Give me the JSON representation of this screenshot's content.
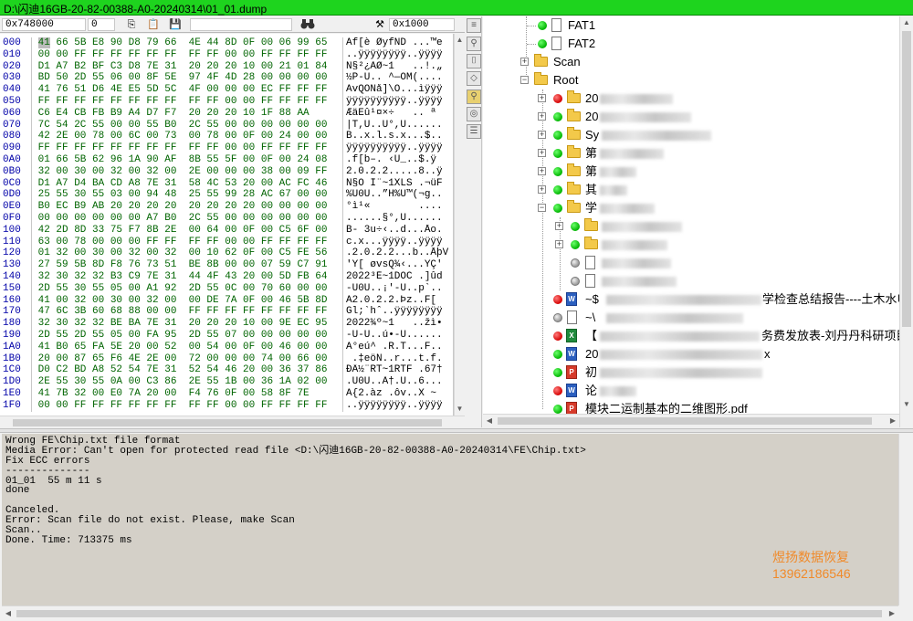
{
  "window": {
    "title": "D:\\闪迪16GB-20-82-00388-A0-20240314\\01_01.dump"
  },
  "hex_toolbar": {
    "offset": "0x748000",
    "value": "0",
    "search_icon": "binoculars-icon",
    "tools_icon": "tools-icon",
    "block_size": "0x1000"
  },
  "hex": {
    "rows": [
      {
        "off": "000",
        "bytes": "41 66 5B E8 90 D8 79 66  4E 44 8D 0F 00 06 99 65",
        "ascii": "Af[è ØyfND ...™e"
      },
      {
        "off": "010",
        "bytes": "00 00 FF FF FF FF FF FF  FF FF 00 00 FF FF FF FF",
        "ascii": "..ÿÿÿÿÿÿÿÿ..ÿÿÿÿ"
      },
      {
        "off": "020",
        "bytes": "D1 A7 B2 BF C3 D8 7E 31  20 20 20 10 00 21 01 84",
        "ascii": "Ñ§²¿ÃØ~1   ..!.„"
      },
      {
        "off": "030",
        "bytes": "BD 50 2D 55 06 00 8F 5E  97 4F 4D 28 00 00 00 00",
        "ascii": "½P-U.. ^—OM(...."
      },
      {
        "off": "040",
        "bytes": "41 76 51 D6 4E E5 5D 5C  4F 00 00 00 EC FF FF FF",
        "ascii": "AvQÖNå]\\O...ìÿÿÿ"
      },
      {
        "off": "050",
        "bytes": "FF FF FF FF FF FF FF FF  FF FF 00 00 FF FF FF FF",
        "ascii": "ÿÿÿÿÿÿÿÿÿÿ..ÿÿÿÿ"
      },
      {
        "off": "060",
        "bytes": "C6 E4 CB FB B9 A4 D7 F7  20 20 20 10 1F 88 AA",
        "ascii": "ÆäËû¹¤×÷   .. ª"
      },
      {
        "off": "070",
        "bytes": "7C 54 2C 55 00 00 55 B0  2C 55 00 00 00 00 00 00",
        "ascii": "|T,U..U°,U......"
      },
      {
        "off": "080",
        "bytes": "42 2E 00 78 00 6C 00 73  00 78 00 0F 00 24 00 00",
        "ascii": "B..x.l.s.x...$.."
      },
      {
        "off": "090",
        "bytes": "FF FF FF FF FF FF FF FF  FF FF 00 00 FF FF FF FF",
        "ascii": "ÿÿÿÿÿÿÿÿÿÿ..ÿÿÿÿ"
      },
      {
        "off": "0A0",
        "bytes": "01 66 5B 62 96 1A 90 AF  8B 55 5F 00 0F 00 24 08",
        "ascii": ".f[b–. ‹U_..$.ÿ"
      },
      {
        "off": "0B0",
        "bytes": "32 00 30 00 32 00 32 00  2E 00 00 00 38 00 09 FF",
        "ascii": "2.0.2.2.....8..ÿ"
      },
      {
        "off": "0C0",
        "bytes": "D1 A7 D4 BA CD A8 7E 31  58 4C 53 20 00 AC FC 46",
        "ascii": "Ñ§Ô Í¨~1XLS .¬üF"
      },
      {
        "off": "0D0",
        "bytes": "25 55 30 55 03 00 94 48  25 55 99 28 AC 67 00 00",
        "ascii": "%U0U..”H%U™(¬g.."
      },
      {
        "off": "0E0",
        "bytes": "B0 EC B9 AB 20 20 20 20  20 20 20 20 00 00 00 00",
        "ascii": "°ì¹«        ...."
      },
      {
        "off": "0F0",
        "bytes": "00 00 00 00 00 00 A7 B0  2C 55 00 00 00 00 00 00",
        "ascii": "......§°,U......"
      },
      {
        "off": "100",
        "bytes": "42 2D 8D 33 75 F7 8B 2E  00 64 00 0F 00 C5 6F 00",
        "ascii": "B- 3u÷‹..d...Åo."
      },
      {
        "off": "110",
        "bytes": "63 00 78 00 00 00 FF FF  FF FF 00 00 FF FF FF FF",
        "ascii": "c.x...ÿÿÿÿ..ÿÿÿÿ"
      },
      {
        "off": "120",
        "bytes": "01 32 00 30 00 32 00 32  00 10 62 0F 00 C5 FE 56",
        "ascii": ".2.0.2.2...b..ÅþV"
      },
      {
        "off": "130",
        "bytes": "27 59 5B 8D F8 76 73 51  BE 8B 00 00 07 59 C7 91",
        "ascii": "'Y[ øvsQ¾‹...YÇ'"
      },
      {
        "off": "140",
        "bytes": "32 30 32 32 B3 C9 7E 31  44 4F 43 20 00 5D FB 64",
        "ascii": "2022³É~1DOC .]ûd"
      },
      {
        "off": "150",
        "bytes": "2D 55 30 55 05 00 A1 92  2D 55 0C 00 70 60 00 00",
        "ascii": "-U0U..¡'-U..p`.."
      },
      {
        "off": "160",
        "bytes": "41 00 32 00 30 00 32 00  00 DE 7A 0F 00 46 5B 8D",
        "ascii": "A2.0.2.2.Þz..F[ "
      },
      {
        "off": "170",
        "bytes": "47 6C 3B 60 68 88 00 00  FF FF FF FF FF FF FF FF",
        "ascii": "Gl;`hˆ..ÿÿÿÿÿÿÿÿ"
      },
      {
        "off": "180",
        "bytes": "32 30 32 32 BE BA 7E 31  20 20 20 10 00 9E EC 95",
        "ascii": "2022¾º~1   ..žì•"
      },
      {
        "off": "190",
        "bytes": "2D 55 2D 55 05 00 FA 95  2D 55 07 00 00 00 00 00",
        "ascii": "-U-U..ú•-U......"
      },
      {
        "off": "1A0",
        "bytes": "41 B0 65 FA 5E 20 00 52  00 54 00 0F 00 46 00 00",
        "ascii": "A°eú^ .R.T...F.."
      },
      {
        "off": "1B0",
        "bytes": "20 00 87 65 F6 4E 2E 00  72 00 00 00 74 00 66 00",
        "ascii": " .‡eöN..r...t.f."
      },
      {
        "off": "1C0",
        "bytes": "D0 C2 BD A8 52 54 7E 31  52 54 46 20 00 36 37 86",
        "ascii": "ÐÂ½¨RT~1RTF .67†"
      },
      {
        "off": "1D0",
        "bytes": "2E 55 30 55 0A 00 C3 86  2E 55 1B 00 36 1A 02 00",
        "ascii": ".U0U..Ã†.U..6..."
      },
      {
        "off": "1E0",
        "bytes": "41 7B 32 00 E0 7A 20 00  F4 76 0F 00 58 8F 7E",
        "ascii": "A{2.àz .ôv..X ~"
      },
      {
        "off": "1F0",
        "bytes": "00 00 FF FF FF FF FF FF  FF FF 00 00 FF FF FF FF",
        "ascii": "..ÿÿÿÿÿÿÿÿ..ÿÿÿÿ"
      }
    ]
  },
  "side_tools": [
    "list-icon",
    "pin-icon",
    "frame-icon",
    "shape-icon",
    "bulb-icon",
    "eye-icon",
    "lines-icon"
  ],
  "tree": {
    "fat1": "FAT1",
    "fat2": "FAT2",
    "scan": "Scan",
    "root": "Root",
    "items": [
      {
        "prefix": "20",
        "suffix": ""
      },
      {
        "prefix": "20",
        "suffix": ""
      },
      {
        "prefix": "Sy",
        "suffix": ""
      },
      {
        "prefix": "第",
        "suffix": ""
      },
      {
        "prefix": "第",
        "suffix": ""
      },
      {
        "prefix": "其",
        "suffix": ""
      },
      {
        "prefix": "学",
        "suffix": ""
      }
    ],
    "files": [
      {
        "prefix": "~$",
        "suffix": "学检查总结报告----土木水电"
      },
      {
        "prefix": "~\\",
        "suffix": ""
      },
      {
        "prefix": "【",
        "suffix": "务费发放表-刘丹丹科研项目"
      },
      {
        "prefix": "20",
        "suffix": "x"
      },
      {
        "prefix": "初",
        "suffix": ""
      },
      {
        "prefix": "论",
        "suffix": ""
      },
      {
        "prefix": "模块二运制基本的二维图形.pdf",
        "suffix": ""
      }
    ]
  },
  "log": {
    "lines": [
      "Wrong FE\\Chip.txt file format",
      "Media Error: Can't open for protected read file <D:\\闪迪16GB-20-82-00388-A0-20240314\\FE\\Chip.txt>",
      "Fix ECC errors",
      "--------------",
      "01_01  55 m 11 s",
      "done",
      "",
      "Canceled.",
      "Error: Scan file do not exist. Please, make Scan",
      "Scan..",
      "Done. Time: 713375 ms"
    ],
    "watermark_name": "煜扬数据恢复",
    "watermark_phone": "13962186546"
  }
}
